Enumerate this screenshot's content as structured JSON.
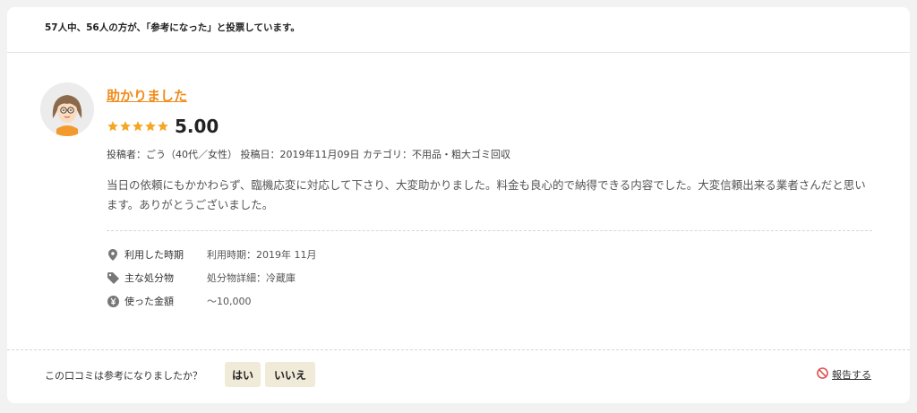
{
  "votes_text": "57人中、56人の方が、「参考になった」と投票しています。",
  "review": {
    "title": "助かりました",
    "rating": 5,
    "score": "5.00",
    "meta": "投稿者：ごう（40代／女性） 投稿日：2019年11月09日 カテゴリ：不用品・粗大ゴミ回収",
    "body": "当日の依頼にもかかわらず、臨機応変に対応して下さり、大変助かりました。料金も良心的で納得できる内容でした。大変信頼出来る業者さんだと思います。ありがとうございました。"
  },
  "details": [
    {
      "icon": "map-pin-icon",
      "label": "利用した時期",
      "value": "利用時期：2019年 11月"
    },
    {
      "icon": "tag-icon",
      "label": "主な処分物",
      "value": "処分物詳細：冷蔵庫"
    },
    {
      "icon": "yen-icon",
      "label": "使った金額",
      "value": "〜10,000"
    }
  ],
  "footer": {
    "question": "この口コミは参考になりましたか？",
    "yes_label": "はい",
    "no_label": "いいえ",
    "report_label": "報告する"
  },
  "colors": {
    "accent": "#f08c1c",
    "star": "#f5a623",
    "button_bg": "#f0ead9",
    "report_icon": "#e05050"
  }
}
